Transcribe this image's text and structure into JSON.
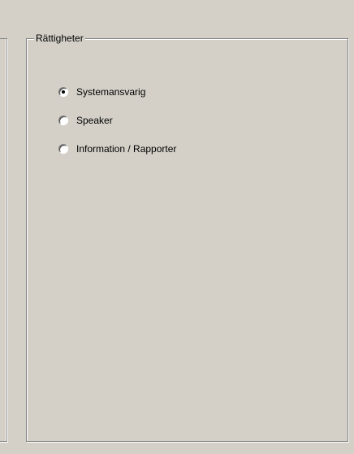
{
  "group": {
    "legend": "Rättigheter",
    "options": [
      {
        "label": "Systemansvarig",
        "checked": true
      },
      {
        "label": "Speaker",
        "checked": false
      },
      {
        "label": "Information / Rapporter",
        "checked": false
      }
    ]
  },
  "colors": {
    "window_background": "#d4d0c8",
    "border_dark": "#808080",
    "border_light": "#ffffff"
  }
}
